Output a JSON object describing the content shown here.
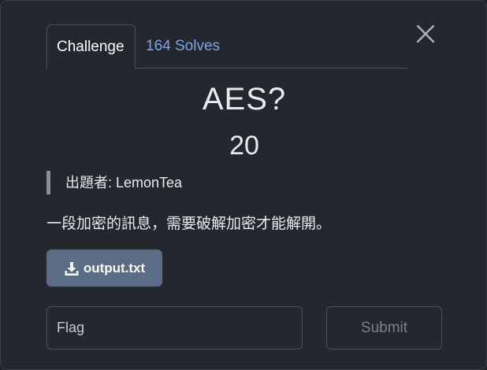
{
  "tabs": {
    "challenge_label": "Challenge",
    "solves_label": "164 Solves"
  },
  "challenge": {
    "title": "AES?",
    "points": "20",
    "author": "出題者: LemonTea",
    "description": "一段加密的訊息，需要破解加密才能解開。"
  },
  "file": {
    "label": "output.txt",
    "icon": "download-icon"
  },
  "flag_input": {
    "value": "",
    "placeholder": "Flag"
  },
  "submit": {
    "label": "Submit"
  },
  "colors": {
    "background": "#23272e",
    "accent_link": "#7aa5e6",
    "file_button": "#5b6d86",
    "submit_disabled_text": "#7b818a"
  }
}
